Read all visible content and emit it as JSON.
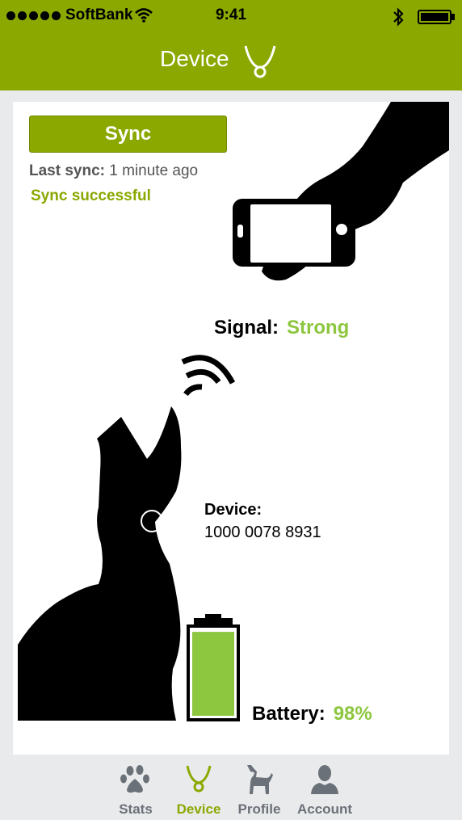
{
  "status_bar": {
    "carrier": "SoftBank",
    "time": "9:41",
    "signal_icon": "signal-dots-icon",
    "wifi_icon": "wifi-icon",
    "bluetooth_icon": "bluetooth-icon",
    "battery_icon": "battery-icon"
  },
  "nav": {
    "title": "Device",
    "icon": "collar-icon"
  },
  "sync": {
    "button_label": "Sync",
    "last_sync_label": "Last sync:",
    "last_sync_value": "1 minute ago",
    "status": "Sync successful"
  },
  "signal": {
    "label": "Signal:",
    "value": "Strong"
  },
  "device": {
    "label": "Device:",
    "id": "1000 0078 8931"
  },
  "battery": {
    "label": "Battery:",
    "value": "98%",
    "level_fraction": 0.98
  },
  "tabs": [
    {
      "label": "Stats",
      "icon": "paw-icon",
      "active": false
    },
    {
      "label": "Device",
      "icon": "collar-icon",
      "active": true
    },
    {
      "label": "Profile",
      "icon": "dog-icon",
      "active": false
    },
    {
      "label": "Account",
      "icon": "person-icon",
      "active": false
    }
  ],
  "colors": {
    "brand_green": "#8aa800",
    "accent_green": "#8dc63f",
    "tab_inactive": "#6b7178"
  }
}
